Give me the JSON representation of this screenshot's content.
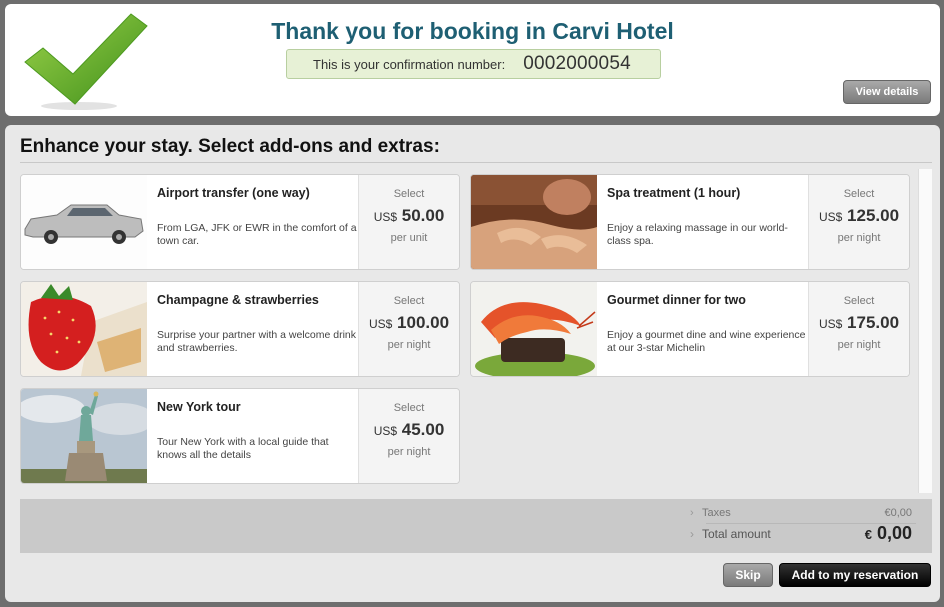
{
  "header": {
    "title": "Thank you for booking in Carvi Hotel",
    "confirmation_label": "This is your confirmation number:",
    "confirmation_number": "0002000054",
    "view_details_label": "View details"
  },
  "addons": {
    "section_title": "Enhance your stay. Select add-ons and extras:",
    "items": [
      {
        "name": "Airport transfer (one way)",
        "description": "From LGA, JFK or EWR in the comfort of a town car.",
        "select": "Select",
        "currency": "US$",
        "price": "50.00",
        "unit": "per unit",
        "image": "town-car"
      },
      {
        "name": "Spa treatment (1 hour)",
        "description": "Enjoy a relaxing massage in our world-class spa.",
        "select": "Select",
        "currency": "US$",
        "price": "125.00",
        "unit": "per night",
        "image": "massage"
      },
      {
        "name": "Champagne & strawberries",
        "description": "Surprise your partner with a welcome drink and strawberries.",
        "select": "Select",
        "currency": "US$",
        "price": "100.00",
        "unit": "per night",
        "image": "strawberry"
      },
      {
        "name": "Gourmet dinner for two",
        "description": "Enjoy a gourmet dine and wine experience at our 3-star Michelin",
        "select": "Select",
        "currency": "US$",
        "price": "175.00",
        "unit": "per night",
        "image": "shrimp-dish"
      },
      {
        "name": "New York tour",
        "description": "Tour New York with a local guide that knows all the details",
        "select": "Select",
        "currency": "US$",
        "price": "45.00",
        "unit": "per night",
        "image": "statue-of-liberty"
      }
    ]
  },
  "totals": {
    "taxes_label": "Taxes",
    "taxes_value": "€0,00",
    "total_label": "Total amount",
    "total_currency": "€",
    "total_value": "0,00"
  },
  "actions": {
    "skip_label": "Skip",
    "add_label": "Add to my reservation"
  },
  "colors": {
    "title": "#1e5f73",
    "confirmation_bg": "#e7f1d6",
    "check_green": "#5fae2a"
  }
}
